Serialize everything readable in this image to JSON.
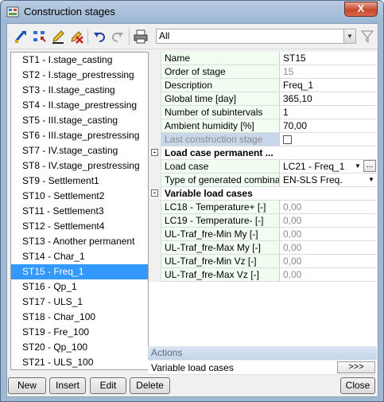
{
  "window": {
    "title": "Construction stages",
    "close_symbol": "X"
  },
  "toolbar": {
    "filter_value": "All"
  },
  "stages": [
    "ST1 - I.stage_casting",
    "ST2 - I.stage_prestressing",
    "ST3 - II.stage_casting",
    "ST4 - II.stage_prestressing",
    "ST5 - III.stage_casting",
    "ST6 - III.stage_prestressing",
    "ST7 - IV.stage_casting",
    "ST8 - IV.stage_prestressing",
    "ST9 - Settlement1",
    "ST10 - Settlement2",
    "ST11 - Settlement3",
    "ST12 - Settlement4",
    "ST13 - Another permanent",
    "ST14 - Char_1",
    "ST15 - Freq_1",
    "ST16 - Qp_1",
    "ST17 - ULS_1",
    "ST18 - Char_100",
    "ST19 - Fre_100",
    "ST20 - Qp_100",
    "ST21 - ULS_100"
  ],
  "selected_stage": "ST15 - Freq_1",
  "properties": {
    "name": {
      "label": "Name",
      "value": "ST15"
    },
    "order": {
      "label": "Order of stage",
      "value": "15"
    },
    "description": {
      "label": "Description",
      "value": "Freq_1"
    },
    "global_time": {
      "label": "Global time [day]",
      "value": "365,10"
    },
    "subintervals": {
      "label": "Number of subintervals",
      "value": "1"
    },
    "humidity": {
      "label": "Ambient humidity [%]",
      "value": "70,00"
    },
    "last_stage": {
      "label": "Last construction stage"
    },
    "group_permanent": {
      "label": "Load case permanent ...",
      "expander": "-"
    },
    "load_case": {
      "label": "Load case",
      "value": "LC21 - Freq_1",
      "ellipsis": "..."
    },
    "gen_type": {
      "label": "Type of generated combina...",
      "value": "EN-SLS Freq."
    },
    "group_variable": {
      "label": "Variable load cases",
      "expander": "-"
    },
    "variable": [
      {
        "label": "LC18 - Temperature+ [-]",
        "value": "0,00"
      },
      {
        "label": "LC19 - Temperature- [-]",
        "value": "0,00"
      },
      {
        "label": "UL-Traf_fre-Min My [-]",
        "value": "0,00"
      },
      {
        "label": "UL-Traf_fre-Max My [-]",
        "value": "0,00"
      },
      {
        "label": "UL-Traf_fre-Min Vz [-]",
        "value": "0,00"
      },
      {
        "label": "UL-Traf_fre-Max Vz [-]",
        "value": "0,00"
      }
    ]
  },
  "actions": {
    "header": "Actions",
    "row_label": "Variable load cases",
    "row_button": ">>>"
  },
  "buttons": {
    "new": "New",
    "insert": "Insert",
    "edit": "Edit",
    "delete": "Delete",
    "close": "Close"
  }
}
